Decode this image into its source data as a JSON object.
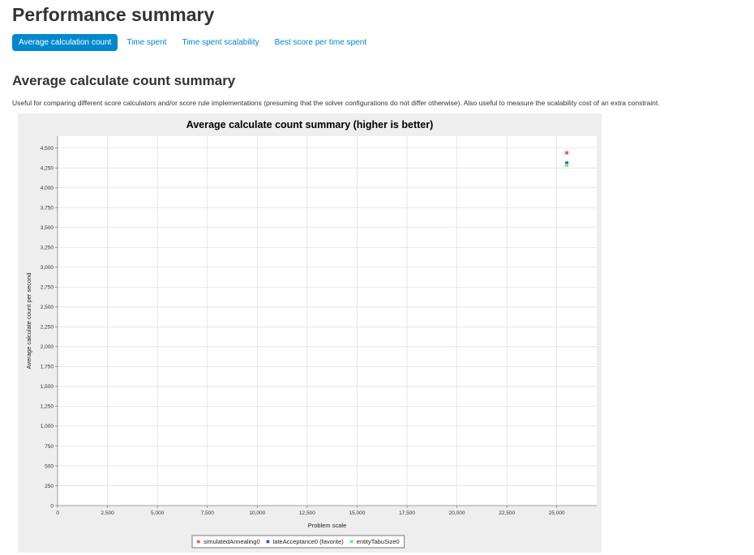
{
  "page": {
    "title": "Performance summary"
  },
  "tabs": [
    {
      "label": "Average calculation count",
      "active": true
    },
    {
      "label": "Time spent",
      "active": false
    },
    {
      "label": "Time spent scalability",
      "active": false
    },
    {
      "label": "Best score per time spent",
      "active": false
    }
  ],
  "section": {
    "title": "Average calculate count summary",
    "description": "Useful for comparing different score calculators and/or score rule implementations (presuming that the solver configurations do not differ otherwise). Also useful to measure the scalability cost of an extra constraint."
  },
  "colors": {
    "accent": "#0088cc"
  },
  "chart_data": {
    "type": "scatter",
    "title": "Average calculate count summary (higher is better)",
    "xlabel": "Problem scale",
    "ylabel": "Average calculate count per second",
    "xlim": [
      0,
      27000
    ],
    "ylim": [
      0,
      4650
    ],
    "grid": true,
    "legend_position": "bottom",
    "x_ticks": [
      0,
      2500,
      5000,
      7500,
      10000,
      12500,
      15000,
      17500,
      20000,
      22500,
      25000
    ],
    "x_tick_labels": [
      "0",
      "2,500",
      "5,000",
      "7,500",
      "10,000",
      "12,500",
      "15,000",
      "17,500",
      "20,000",
      "22,500",
      "25,000"
    ],
    "y_ticks": [
      0,
      250,
      500,
      750,
      1000,
      1250,
      1500,
      1750,
      2000,
      2250,
      2500,
      2750,
      3000,
      3250,
      3500,
      3750,
      4000,
      4250,
      4500
    ],
    "y_tick_labels": [
      "0",
      "250",
      "500",
      "750",
      "1,000",
      "1,250",
      "1,500",
      "1,750",
      "2,000",
      "2,250",
      "2,500",
      "2,750",
      "3,000",
      "3,250",
      "3,500",
      "3,750",
      "4,000",
      "4,250",
      "4,500"
    ],
    "series": [
      {
        "name": "simulatedAnnealing0",
        "color": "#ff5555",
        "points": [
          {
            "x": 25500,
            "y": 4440
          }
        ]
      },
      {
        "name": "lateAcceptance0 (favorite)",
        "color": "#3344ee",
        "points": [
          {
            "x": 25500,
            "y": 4310
          }
        ]
      },
      {
        "name": "entityTabuSize0",
        "color": "#55ff55",
        "points": [
          {
            "x": 25500,
            "y": 4285
          }
        ]
      }
    ]
  }
}
